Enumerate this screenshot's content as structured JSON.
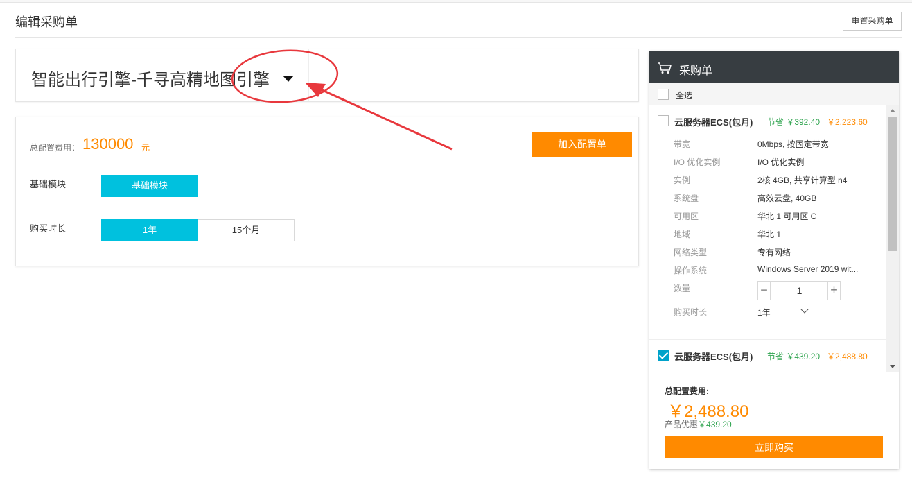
{
  "page": {
    "title": "编辑采购单",
    "reset_label": "重置采购单"
  },
  "product": {
    "name": "智能出行引擎-千寻高精地图引擎"
  },
  "config": {
    "total_label": "总配置费用：",
    "total_value": "130000",
    "total_unit": "元",
    "add_button": "加入配置单",
    "rows": [
      {
        "label": "基础模块",
        "options": [
          "基础模块"
        ],
        "selected": 0
      },
      {
        "label": "购买时长",
        "options": [
          "1年",
          "15个月"
        ],
        "selected": 0
      }
    ]
  },
  "cart": {
    "title": "采购单",
    "select_all": "全选",
    "items": [
      {
        "checked": false,
        "name": "云服务器ECS(包月)",
        "save": "节省 ￥392.40",
        "price": "￥2,223.60",
        "specs": [
          {
            "label": "带宽",
            "value": "0Mbps, 按固定带宽"
          },
          {
            "label": "I/O 优化实例",
            "value": "I/O 优化实例"
          },
          {
            "label": "实例",
            "value": "2核 4GB, 共享计算型 n4"
          },
          {
            "label": "系统盘",
            "value": "高效云盘, 40GB"
          },
          {
            "label": "可用区",
            "value": "华北 1 可用区 C"
          },
          {
            "label": "地域",
            "value": "华北 1"
          },
          {
            "label": "网络类型",
            "value": "专有网络"
          },
          {
            "label": "操作系统",
            "value": "Windows Server 2019 wit..."
          }
        ],
        "qty_label": "数量",
        "qty": "1",
        "period_label": "购买时长",
        "period": "1年"
      },
      {
        "checked": true,
        "name": "云服务器ECS(包月)",
        "save": "节省 ￥439.20",
        "price": "￥2,488.80"
      }
    ],
    "footer": {
      "label": "总配置费用:",
      "total": "￥2,488.80",
      "discount_label": "产品优惠",
      "discount_value": "￥439.20",
      "buy_button": "立即购买"
    }
  },
  "colors": {
    "accent_orange": "#ff8a00",
    "active_cyan": "#00c1de",
    "header_dark": "#373d41",
    "save_green": "#2fa44f",
    "annotation_red": "#e8383d"
  },
  "icons": [
    "cart-icon",
    "dropdown-arrow-icon",
    "checkbox-icon",
    "chevron-down-icon",
    "minus-icon",
    "plus-icon"
  ]
}
